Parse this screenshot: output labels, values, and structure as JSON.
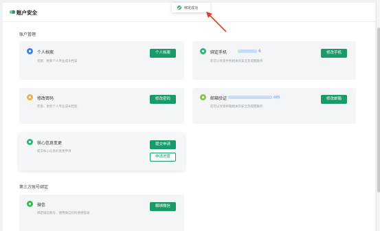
{
  "panel": {
    "title": "账户安全"
  },
  "account_section": {
    "label": "账户管理"
  },
  "cards": {
    "profile": {
      "title": "个人档案",
      "desc": "完善、更新个人专业成长档案",
      "button": "个人档案",
      "icon": "profile-icon",
      "icon_color": "#3e7ef2"
    },
    "phone": {
      "title": "绑定手机",
      "value_suffix": "6",
      "desc": "您可以享受手机相关的安全及提醒服务",
      "button": "修改手机",
      "icon": "phone-icon",
      "icon_color": "#29b87a"
    },
    "password": {
      "title": "修改密码",
      "desc": "完善、更新个人专业成长档案",
      "button": "修改密码",
      "icon": "lock-icon",
      "icon_color": "#f5b03d"
    },
    "email": {
      "title": "邮箱验证",
      "value_suffix": "om",
      "desc": "您可以享受邮箱相关的安全及提醒服务",
      "button": "修改邮箱",
      "icon": "mail-icon",
      "icon_color": "#8cc53f"
    },
    "core_info": {
      "title": "核心信息变更",
      "desc": "提交核心信息的变更申请",
      "button": "提交申请",
      "button2": "申请进度",
      "icon": "edit-icon",
      "icon_color": "#29b87a"
    },
    "wechat": {
      "title": "微信",
      "desc": "绑定微信账号，使用微信扫码便捷登录",
      "button": "解绑微信",
      "icon": "wechat-icon",
      "icon_color": "#2bbd4e"
    }
  },
  "third_party_section": {
    "label": "第三方账号绑定"
  },
  "toast": {
    "text": "绑定成功",
    "icon": "success-check-icon"
  },
  "colors": {
    "accent": "#1a9a6a",
    "toast_success": "#2bb35a",
    "arrow": "#e23b2a"
  }
}
